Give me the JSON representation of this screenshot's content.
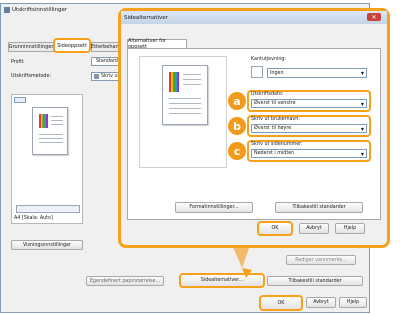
{
  "back_window": {
    "title": "Utskriftsinnstillinger",
    "tabs": [
      "Grunninnstillinger",
      "Sideoppsett",
      "Etterbehandling"
    ],
    "profile_label": "Profil:",
    "profile_value": "Standardinnstillinger",
    "output_label": "Utskriftsmetode:",
    "output_value": "Skriv ut",
    "paper_size_caption": "A4 [Skala: Auto]",
    "view_settings_button": "Visningsinnstillinger",
    "custom_paper_button": "Egendefinert papirstørrelse...",
    "page_options_button": "Sidealternativer...",
    "restore_defaults_button": "Tilbakestill standarder",
    "watermark_button": "Rediger vannmerke...",
    "ok_button": "OK",
    "cancel_button": "Avbryt",
    "help_button": "Hjelp"
  },
  "dialog": {
    "title": "Sidealternativer",
    "tab": "Alternativer for oppsett",
    "border_label": "Kantutjevning:",
    "border_value": "Ingen",
    "print_date_label": "Utskriftsdato:",
    "print_date_value": "Øverst til venstre",
    "user_name_label": "Skriv ut brukernavn:",
    "user_name_value": "Øverst til høyre",
    "page_number_label": "Skriv ut sidenummer:",
    "page_number_value": "Nederst i midten",
    "formatting_button": "Formatinnstillinger...",
    "restore_defaults_button": "Tilbakestill standarder",
    "ok_button": "OK",
    "cancel_button": "Avbryt",
    "help_button": "Hjelp"
  },
  "callouts": [
    "a",
    "b",
    "c"
  ],
  "colors": {
    "accent": "#f7a11a",
    "close": "#c9433a",
    "window_border": "#7f9db9"
  }
}
